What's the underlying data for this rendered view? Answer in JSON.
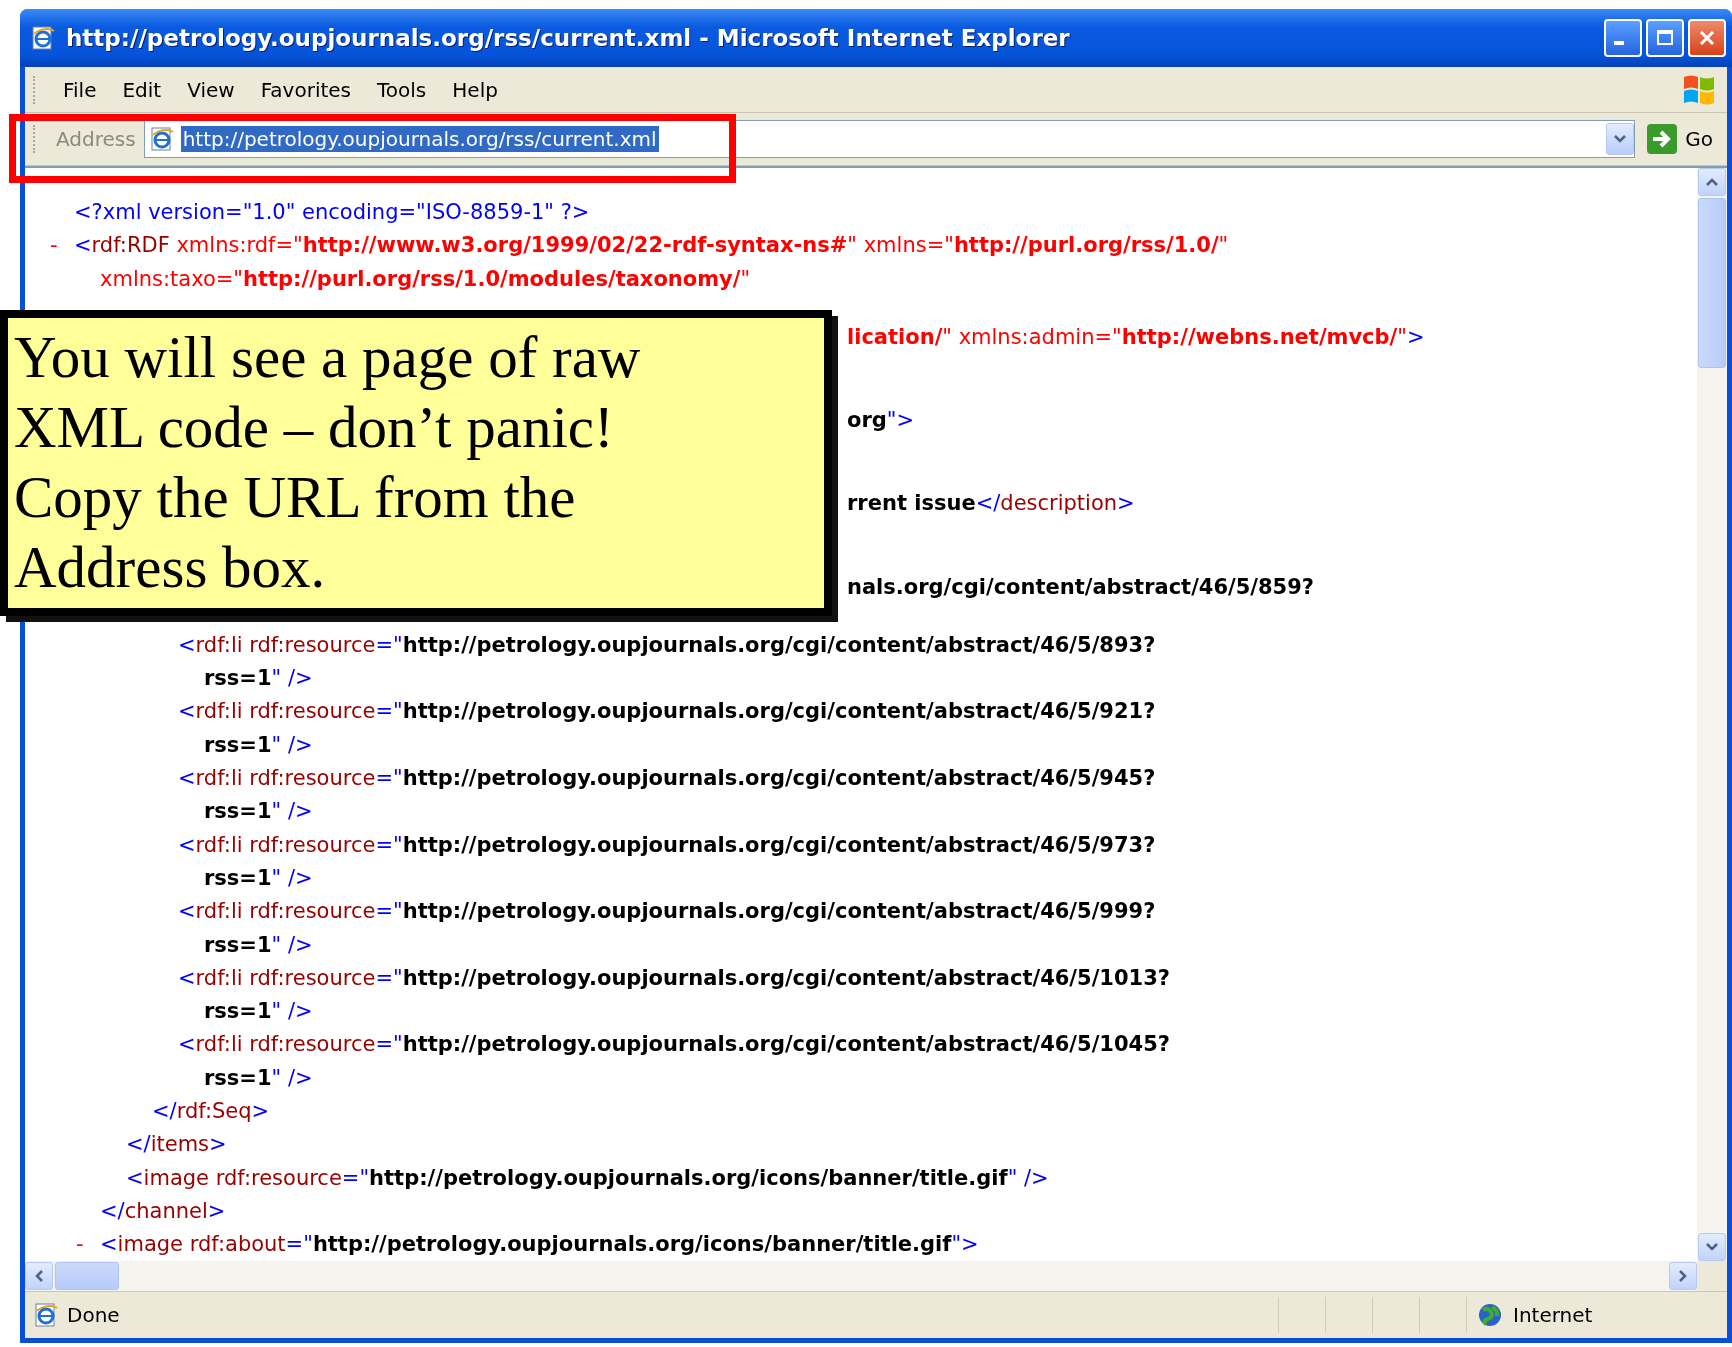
{
  "window": {
    "title": "http://petrology.oupjournals.org/rss/current.xml - Microsoft Internet Explorer"
  },
  "menu": [
    "File",
    "Edit",
    "View",
    "Favorites",
    "Tools",
    "Help"
  ],
  "address_bar": {
    "label": "Address",
    "url": "http://petrology.oupjournals.org/rss/current.xml",
    "go_label": "Go"
  },
  "xml_view": {
    "nodes": [
      {
        "kind": "element",
        "lines": [
          [
            {
              "kind": "markup",
              "text": "<?xml version=\"1.0\" encoding=\"ISO-8859-1\" ?>"
            }
          ]
        ]
      },
      {
        "kind": "element",
        "toggle": "-",
        "lines": [
          [
            {
              "kind": "markup",
              "text": "<"
            },
            {
              "kind": "name",
              "text": "rdf:RDF"
            },
            {
              "kind": "ns",
              "text": " xmlns:rdf=\""
            },
            {
              "kind": "nsvalue",
              "text": "http://www.w3.org/1999/02/22-rdf-syntax-ns#"
            },
            {
              "kind": "ns",
              "text": "\" xmlns=\""
            },
            {
              "kind": "nsvalue",
              "text": "http://purl.org/rss/1.0/"
            },
            {
              "kind": "ns",
              "text": "\""
            }
          ],
          [
            {
              "kind": "ns",
              "text": "xmlns:taxo=\""
            },
            {
              "kind": "nsvalue",
              "text": "http://purl.org/rss/1.0/modules/taxonomy/"
            },
            {
              "kind": "ns",
              "text": "\""
            }
          ]
        ],
        "children": [
          {
            "kind": "covered",
            "fragments": [
              [
                {
                  "kind": "nsvalue",
                  "text": "lication/"
                },
                {
                  "kind": "ns",
                  "text": "\" xmlns:admin=\""
                },
                {
                  "kind": "nsvalue",
                  "text": "http://webns.net/mvcb/"
                },
                {
                  "kind": "ns",
                  "text": "\""
                },
                {
                  "kind": "markup",
                  "text": ">"
                }
              ],
              [
                {
                  "kind": "value",
                  "text": "org"
                },
                {
                  "kind": "markup",
                  "text": "\">"
                }
              ],
              [
                {
                  "kind": "value",
                  "text": "rrent issue"
                },
                {
                  "kind": "markup",
                  "text": "</"
                },
                {
                  "kind": "name",
                  "text": "description"
                },
                {
                  "kind": "markup",
                  "text": ">"
                }
              ],
              [
                {
                  "kind": "value",
                  "text": "nals.org/cgi/content/abstract/46/5/859?"
                }
              ]
            ]
          },
          {
            "kind": "element",
            "close": [
              {
                "kind": "markup",
                "text": "</"
              },
              {
                "kind": "name",
                "text": "channel"
              },
              {
                "kind": "markup",
                "text": ">"
              }
            ],
            "children": [
              {
                "kind": "element",
                "close": [
                  {
                    "kind": "markup",
                    "text": "</"
                  },
                  {
                    "kind": "name",
                    "text": "items"
                  },
                  {
                    "kind": "markup",
                    "text": ">"
                  }
                ],
                "children": [
                  {
                    "kind": "element",
                    "close": [
                      {
                        "kind": "markup",
                        "text": "</"
                      },
                      {
                        "kind": "name",
                        "text": "rdf:Seq"
                      },
                      {
                        "kind": "markup",
                        "text": ">"
                      }
                    ],
                    "children": [
                      {
                        "kind": "element",
                        "lines": [
                          [
                            {
                              "kind": "markup",
                              "text": "<"
                            },
                            {
                              "kind": "name",
                              "text": "rdf:li rdf:resource"
                            },
                            {
                              "kind": "markup",
                              "text": "=\""
                            },
                            {
                              "kind": "value",
                              "text": "http://petrology.oupjournals.org/cgi/content/abstract/46/5/893?"
                            }
                          ],
                          [
                            {
                              "kind": "value",
                              "text": "rss=1"
                            },
                            {
                              "kind": "markup",
                              "text": "\" />"
                            }
                          ]
                        ]
                      },
                      {
                        "kind": "element",
                        "lines": [
                          [
                            {
                              "kind": "markup",
                              "text": "<"
                            },
                            {
                              "kind": "name",
                              "text": "rdf:li rdf:resource"
                            },
                            {
                              "kind": "markup",
                              "text": "=\""
                            },
                            {
                              "kind": "value",
                              "text": "http://petrology.oupjournals.org/cgi/content/abstract/46/5/921?"
                            }
                          ],
                          [
                            {
                              "kind": "value",
                              "text": "rss=1"
                            },
                            {
                              "kind": "markup",
                              "text": "\" />"
                            }
                          ]
                        ]
                      },
                      {
                        "kind": "element",
                        "lines": [
                          [
                            {
                              "kind": "markup",
                              "text": "<"
                            },
                            {
                              "kind": "name",
                              "text": "rdf:li rdf:resource"
                            },
                            {
                              "kind": "markup",
                              "text": "=\""
                            },
                            {
                              "kind": "value",
                              "text": "http://petrology.oupjournals.org/cgi/content/abstract/46/5/945?"
                            }
                          ],
                          [
                            {
                              "kind": "value",
                              "text": "rss=1"
                            },
                            {
                              "kind": "markup",
                              "text": "\" />"
                            }
                          ]
                        ]
                      },
                      {
                        "kind": "element",
                        "lines": [
                          [
                            {
                              "kind": "markup",
                              "text": "<"
                            },
                            {
                              "kind": "name",
                              "text": "rdf:li rdf:resource"
                            },
                            {
                              "kind": "markup",
                              "text": "=\""
                            },
                            {
                              "kind": "value",
                              "text": "http://petrology.oupjournals.org/cgi/content/abstract/46/5/973?"
                            }
                          ],
                          [
                            {
                              "kind": "value",
                              "text": "rss=1"
                            },
                            {
                              "kind": "markup",
                              "text": "\" />"
                            }
                          ]
                        ]
                      },
                      {
                        "kind": "element",
                        "lines": [
                          [
                            {
                              "kind": "markup",
                              "text": "<"
                            },
                            {
                              "kind": "name",
                              "text": "rdf:li rdf:resource"
                            },
                            {
                              "kind": "markup",
                              "text": "=\""
                            },
                            {
                              "kind": "value",
                              "text": "http://petrology.oupjournals.org/cgi/content/abstract/46/5/999?"
                            }
                          ],
                          [
                            {
                              "kind": "value",
                              "text": "rss=1"
                            },
                            {
                              "kind": "markup",
                              "text": "\" />"
                            }
                          ]
                        ]
                      },
                      {
                        "kind": "element",
                        "lines": [
                          [
                            {
                              "kind": "markup",
                              "text": "<"
                            },
                            {
                              "kind": "name",
                              "text": "rdf:li rdf:resource"
                            },
                            {
                              "kind": "markup",
                              "text": "=\""
                            },
                            {
                              "kind": "value",
                              "text": "http://petrology.oupjournals.org/cgi/content/abstract/46/5/1013?"
                            }
                          ],
                          [
                            {
                              "kind": "value",
                              "text": "rss=1"
                            },
                            {
                              "kind": "markup",
                              "text": "\" />"
                            }
                          ]
                        ]
                      },
                      {
                        "kind": "element",
                        "lines": [
                          [
                            {
                              "kind": "markup",
                              "text": "<"
                            },
                            {
                              "kind": "name",
                              "text": "rdf:li rdf:resource"
                            },
                            {
                              "kind": "markup",
                              "text": "=\""
                            },
                            {
                              "kind": "value",
                              "text": "http://petrology.oupjournals.org/cgi/content/abstract/46/5/1045?"
                            }
                          ],
                          [
                            {
                              "kind": "value",
                              "text": "rss=1"
                            },
                            {
                              "kind": "markup",
                              "text": "\" />"
                            }
                          ]
                        ]
                      }
                    ]
                  }
                ]
              },
              {
                "kind": "element",
                "lines": [
                  [
                    {
                      "kind": "markup",
                      "text": "<"
                    },
                    {
                      "kind": "name",
                      "text": "image rdf:resource"
                    },
                    {
                      "kind": "markup",
                      "text": "=\""
                    },
                    {
                      "kind": "value",
                      "text": "http://petrology.oupjournals.org/icons/banner/title.gif"
                    },
                    {
                      "kind": "markup",
                      "text": "\" />"
                    }
                  ]
                ]
              }
            ]
          },
          {
            "kind": "element",
            "toggle": "-",
            "lines": [
              [
                {
                  "kind": "markup",
                  "text": "<"
                },
                {
                  "kind": "name",
                  "text": "image rdf:about"
                },
                {
                  "kind": "markup",
                  "text": "=\""
                },
                {
                  "kind": "value",
                  "text": "http://petrology.oupjournals.org/icons/banner/title.gif"
                },
                {
                  "kind": "markup",
                  "text": "\">"
                }
              ]
            ]
          }
        ]
      }
    ]
  },
  "callout": {
    "text": "You will see a page of raw XML code – don’t panic! Copy the URL from the Address box."
  },
  "status_bar": {
    "status": "Done",
    "zone": "Internet"
  }
}
